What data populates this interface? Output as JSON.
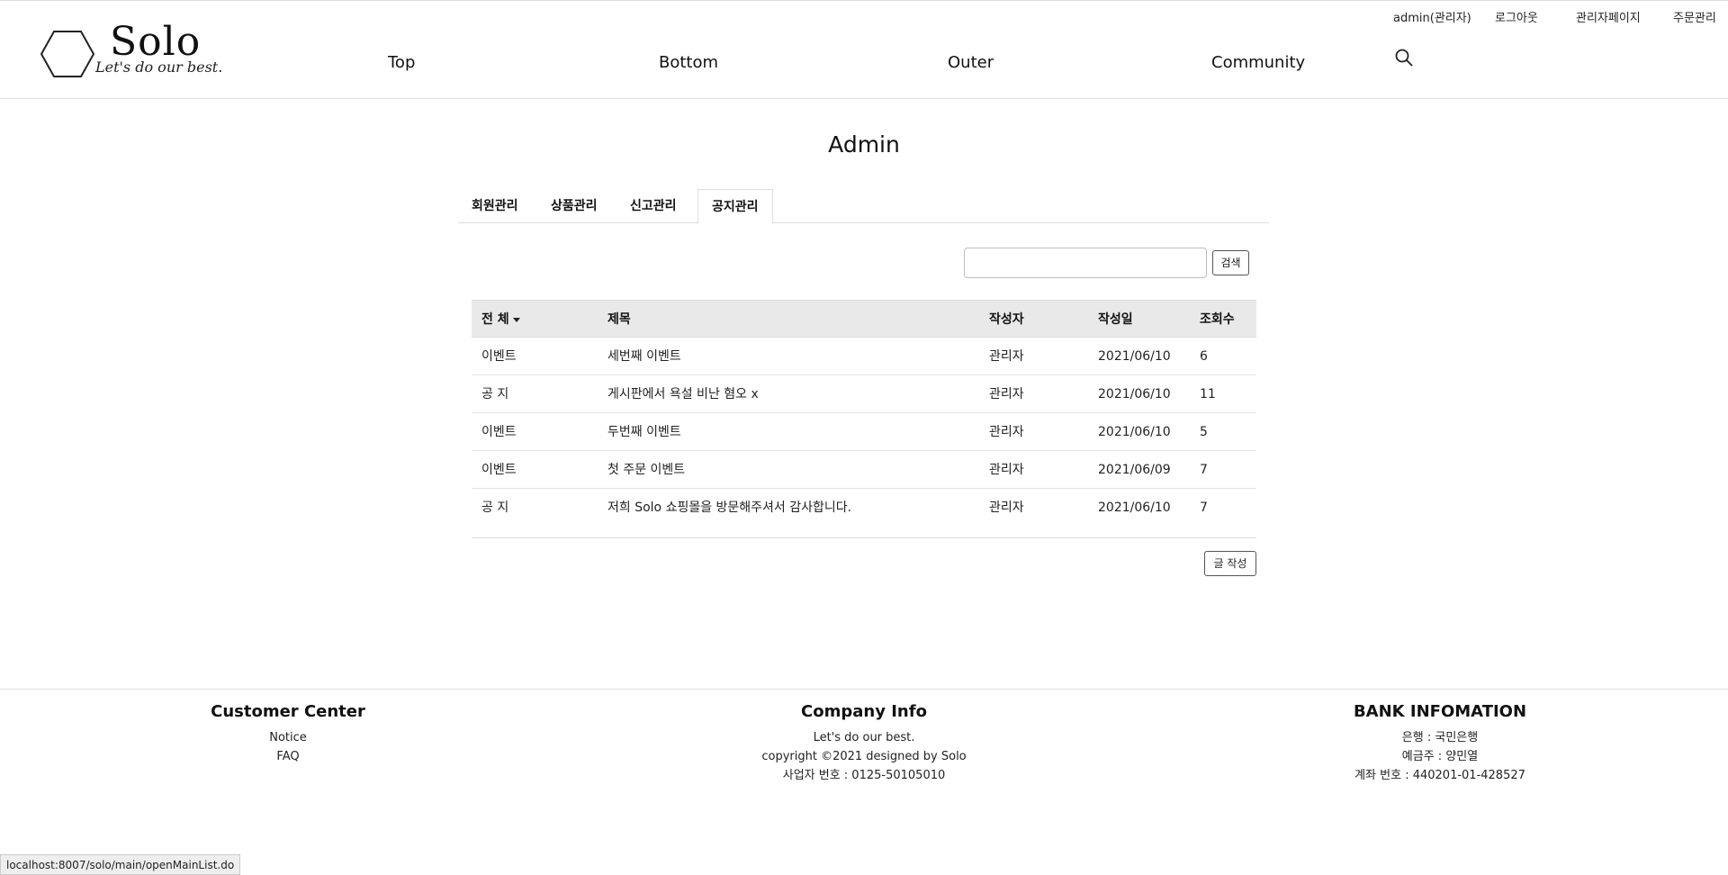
{
  "brand": {
    "name": "Solo",
    "slogan": "Let's do our best."
  },
  "topbar": {
    "user": "admin(관리자)",
    "logout": "로그아웃",
    "admin_page": "관리자페이지",
    "order_manage": "주문관리"
  },
  "nav": {
    "top": "Top",
    "bottom": "Bottom",
    "outer": "Outer",
    "community": "Community"
  },
  "page": {
    "title": "Admin"
  },
  "tabs": [
    {
      "label": "회원관리"
    },
    {
      "label": "상품관리"
    },
    {
      "label": "신고관리"
    },
    {
      "label": "공지관리"
    }
  ],
  "search": {
    "value": "",
    "button": "검색"
  },
  "table": {
    "headers": {
      "category": "전 체",
      "title": "제목",
      "author": "작성자",
      "date": "작성일",
      "views": "조회수"
    },
    "rows": [
      {
        "category": "이벤트",
        "title": "세번째 이벤트",
        "author": "관리자",
        "date": "2021/06/10",
        "views": "6"
      },
      {
        "category": "공 지",
        "title": "게시판에서 욕설 비난 혐오 x",
        "author": "관리자",
        "date": "2021/06/10",
        "views": "11"
      },
      {
        "category": "이벤트",
        "title": "두번째 이벤트",
        "author": "관리자",
        "date": "2021/06/10",
        "views": "5"
      },
      {
        "category": "이벤트",
        "title": "첫 주문 이벤트",
        "author": "관리자",
        "date": "2021/06/09",
        "views": "7"
      },
      {
        "category": "공 지",
        "title": "저희 Solo 쇼핑몰을 방문해주셔서 감사합니다.",
        "author": "관리자",
        "date": "2021/06/10",
        "views": "7"
      }
    ]
  },
  "write_button": "글 작성",
  "footer": {
    "customer": {
      "title": "Customer Center",
      "notice": "Notice",
      "faq": "FAQ"
    },
    "company": {
      "title": "Company Info",
      "line1": "Let's do our best.",
      "line2": "copyright ©2021 designed by Solo",
      "line3": "사업자 번호 : 0125-50105010"
    },
    "bank": {
      "title": "BANK INFOMATION",
      "line1": "은행 : 국민은행",
      "line2": "예금주 : 양민열",
      "line3": "계좌 번호 : 440201-01-428527"
    }
  },
  "statusbar": {
    "url": "localhost:8007/solo/main/openMainList.do"
  }
}
